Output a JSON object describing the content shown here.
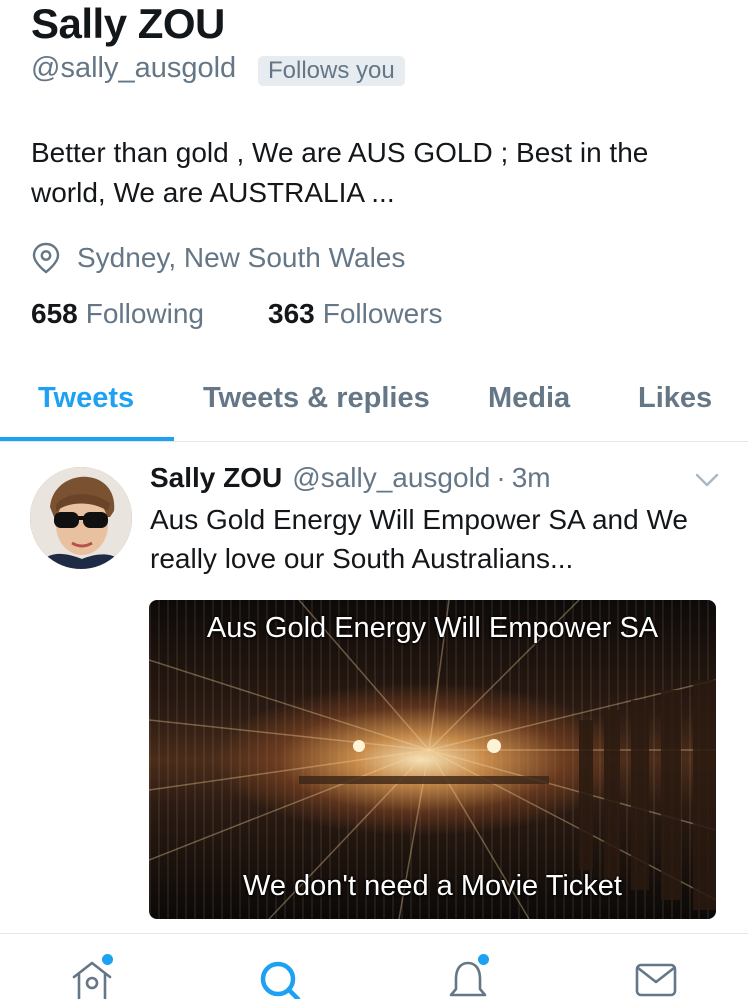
{
  "profile": {
    "name": "Sally ZOU",
    "handle": "@sally_ausgold",
    "follows_you": "Follows you",
    "bio": "Better than gold , We are AUS GOLD ; Best in the world, We are AUSTRALIA ...",
    "location": "Sydney, New South Wales",
    "following_count": "658",
    "following_label": "Following",
    "followers_count": "363",
    "followers_label": "Followers"
  },
  "tabs": [
    {
      "label": "Tweets",
      "active": true
    },
    {
      "label": "Tweets & replies",
      "active": false
    },
    {
      "label": "Media",
      "active": false
    },
    {
      "label": "Likes",
      "active": false
    }
  ],
  "tweet": {
    "author_name": "Sally ZOU",
    "author_handle": "@sally_ausgold",
    "separator": "·",
    "time": "3m",
    "text": "Aus Gold Energy Will Empower SA and We really love our South Australians...",
    "media": {
      "caption_top": "Aus Gold Energy Will Empower SA",
      "caption_bottom": "We don't need a Movie Ticket"
    }
  },
  "bottom_nav": [
    {
      "icon": "home-icon",
      "notification_dot": true
    },
    {
      "icon": "search-icon",
      "notification_dot": false
    },
    {
      "icon": "bell-icon",
      "notification_dot": true
    },
    {
      "icon": "mail-icon",
      "notification_dot": false
    }
  ],
  "colors": {
    "accent": "#1da1f2",
    "secondary_text": "#657786",
    "primary_text": "#14171a",
    "badge_bg": "#e6ecf0"
  }
}
